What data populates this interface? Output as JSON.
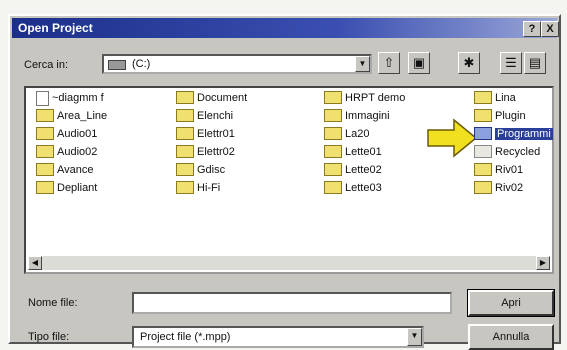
{
  "dialog": {
    "title": "Open Project",
    "help_button": "?",
    "close_button": "X"
  },
  "lookin": {
    "label": "Cerca in:",
    "value": "(C:)"
  },
  "toolbar": {
    "icons": [
      "up-folder-icon",
      "desktop-icon",
      "new-folder-icon",
      "list-view-icon",
      "details-view-icon"
    ]
  },
  "files": {
    "col1": [
      "~diagmm f",
      "Area_Line",
      "Audio01",
      "Audio02",
      "Avance",
      "Depliant"
    ],
    "col2": [
      "Document",
      "Elenchi",
      "Elettr01",
      "Elettr02",
      "Gdisc",
      "Hi-Fi"
    ],
    "col3": [
      "HRPT demo",
      "Immagini",
      "La20",
      "Lette01",
      "Lette02",
      "Lette03"
    ],
    "col4": [
      "Lina",
      "Plugin",
      "Programmi",
      "Recycled",
      "Riv01",
      "Riv02"
    ],
    "selected": "Programmi"
  },
  "filename": {
    "label": "Nome file:",
    "value": ""
  },
  "filetype": {
    "label": "Tipo file:",
    "value": "Project file (*.mpp)"
  },
  "buttons": {
    "open": "Apri",
    "cancel": "Annulla"
  },
  "colors": {
    "title_bar": "#1b2f8a",
    "highlight_arrow": "#f0e020",
    "selection": "#2a3f9a"
  }
}
